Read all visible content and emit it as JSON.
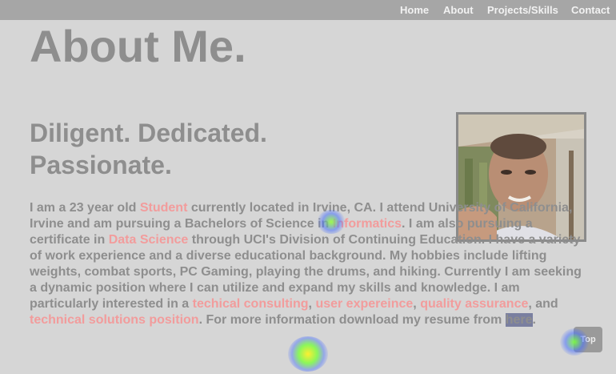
{
  "nav": {
    "home": "Home",
    "about": "About",
    "projects": "Projects/Skills",
    "contact": "Contact"
  },
  "page_title": "About Me.",
  "tagline": {
    "line1": "Diligent. Dedicated.",
    "line2": "Passionate."
  },
  "bio": {
    "t1": "I am a 23 year old ",
    "h1": "Student",
    "t2": " currently located in Irvine, CA. I attend University of California, Irvine and am pursuing a Bachelors of Science in ",
    "h2": "Informatics",
    "t3": ". I am also pursuing a certificate in ",
    "h3": "Data Science",
    "t4": " through UCI's Division of Continuing Education. I have a variety of work experience and a diverse educational background. My hobbies include lifting weights, combat sports, PC Gaming, playing the drums, and hiking. Currently I am seeking a dynamic position where I can utilize and expand my skills and knowledge. I am particularly interested in a ",
    "h4": "techical consulting",
    "t5": ", ",
    "h5": "user expereince",
    "t6": ", ",
    "h6": "quality assurance",
    "t7": ", and ",
    "h7": "technical solutions position",
    "t8": ". For more information download my resume from ",
    "link": "here",
    "t9": "."
  },
  "top_button": "Top",
  "colors": {
    "background": "#d6d6d6",
    "navbar": "#a6a6a6",
    "text": "#8e8e8e",
    "highlight": "#f29c9c"
  }
}
